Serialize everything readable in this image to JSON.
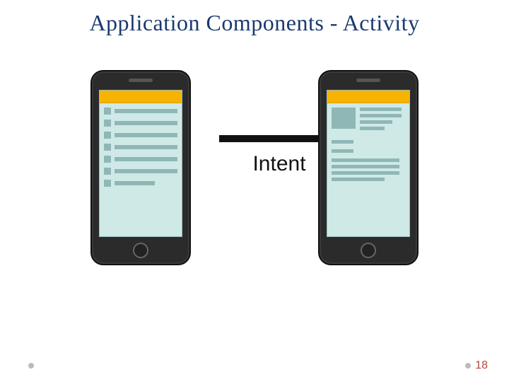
{
  "title": "Application Components - Activity",
  "arrow_label": "Intent",
  "page_number": "18",
  "icons": {
    "bullet": "•"
  },
  "colors": {
    "title": "#1a3a6e",
    "accent_bar": "#f6b400",
    "screen_bg": "#cfe9e7",
    "placeholder": "#8fb7b5",
    "page_number": "#b44a3a"
  }
}
